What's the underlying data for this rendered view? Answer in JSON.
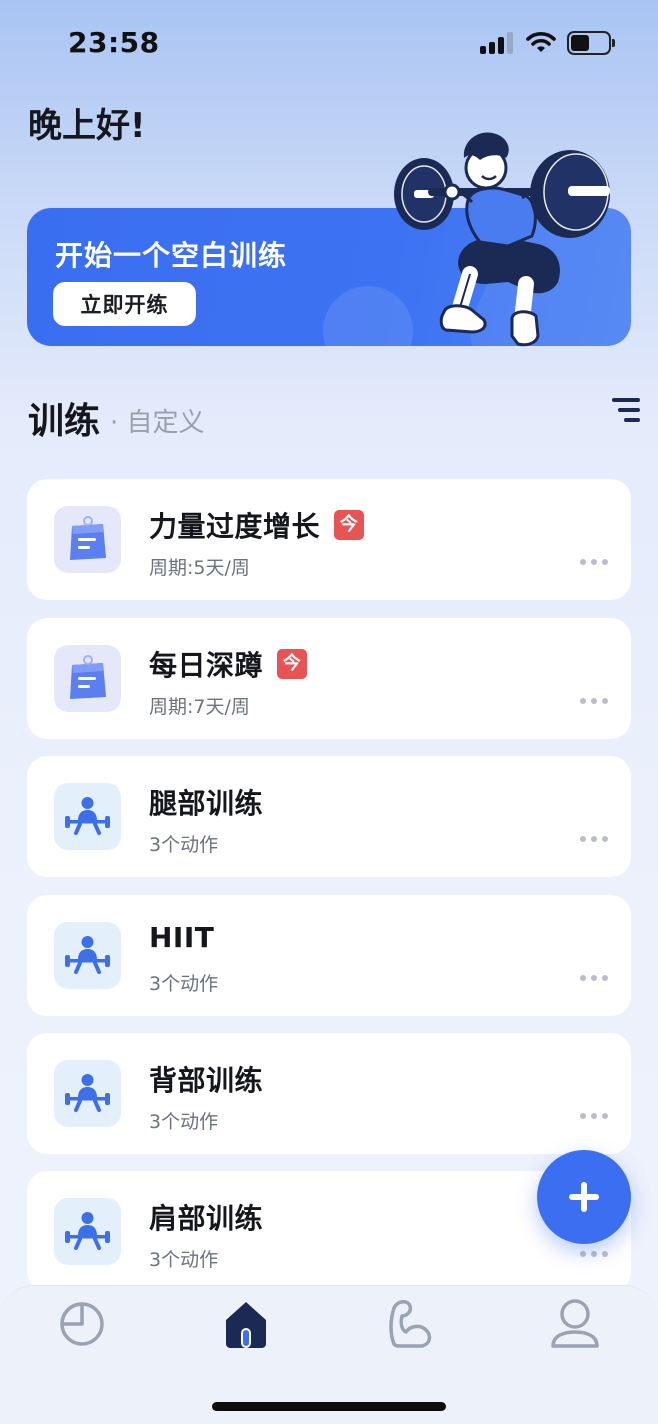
{
  "status_bar": {
    "time": "23:58",
    "signal_icon": "cellular-signal-icon",
    "wifi_icon": "wifi-icon",
    "battery_icon": "battery-icon"
  },
  "greeting": "晚上好!",
  "banner": {
    "title": "开始一个空白训练",
    "button_label": "立即开练",
    "illustration": "barbell-squat-illustration",
    "color": "#3b6ff0"
  },
  "section": {
    "title": "训练",
    "subtitle": "· 自定义",
    "sort_icon": "sort-list-icon"
  },
  "plans": [
    {
      "name": "力量过度增长",
      "badge": "今",
      "sub": "周期:5天/周",
      "icon": "plan-clipboard-icon"
    },
    {
      "name": "每日深蹲",
      "badge": "今",
      "sub": "周期:7天/周",
      "icon": "plan-clipboard-icon"
    }
  ],
  "workouts": [
    {
      "name": "腿部训练",
      "sub": "3个动作",
      "icon": "weightlifter-icon"
    },
    {
      "name": "HIIT",
      "sub": "3个动作",
      "icon": "weightlifter-icon"
    },
    {
      "name": "背部训练",
      "sub": "3个动作",
      "icon": "weightlifter-icon"
    },
    {
      "name": "肩部训练",
      "sub": "3个动作",
      "icon": "weightlifter-icon"
    }
  ],
  "fab_icon": "plus-icon",
  "tabbar": {
    "tabs": [
      {
        "icon": "pie-chart-icon",
        "active": false
      },
      {
        "icon": "home-icon",
        "active": true
      },
      {
        "icon": "muscle-arm-icon",
        "active": false
      },
      {
        "icon": "profile-icon",
        "active": false
      }
    ]
  },
  "colors": {
    "accent": "#3b6ef0",
    "badge_red": "#e85454",
    "navy": "#1b2a55"
  }
}
